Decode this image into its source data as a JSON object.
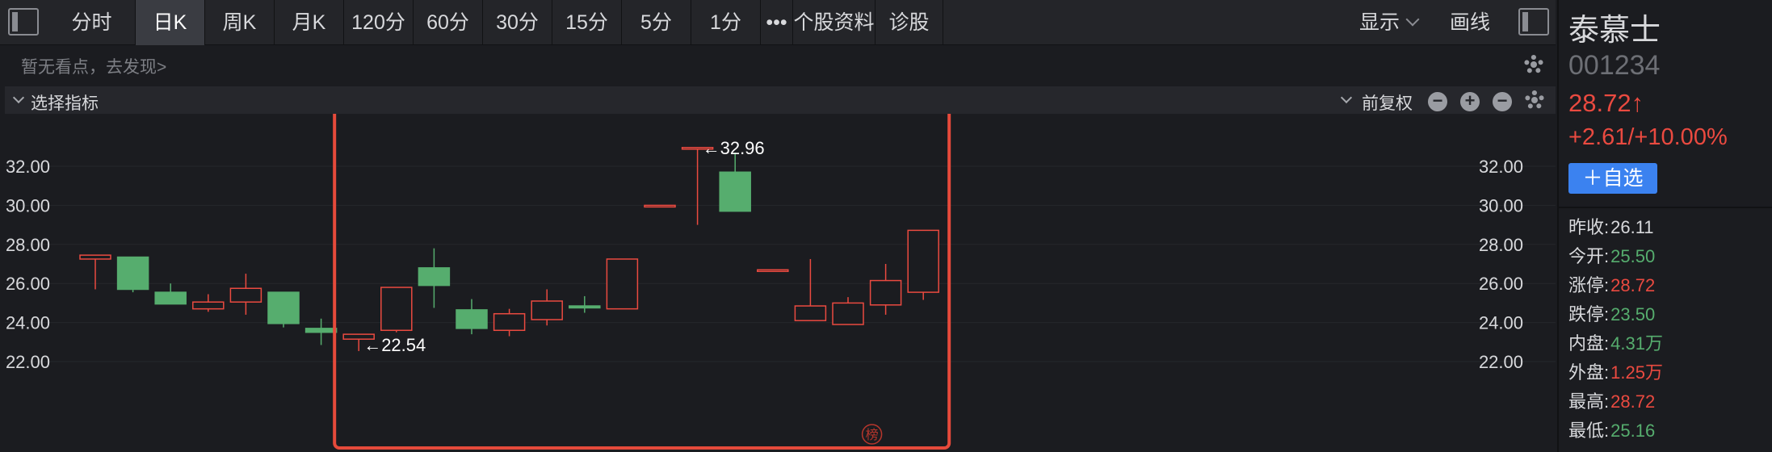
{
  "toolbar": {
    "tabs": [
      {
        "label": "分时",
        "active": false
      },
      {
        "label": "日K",
        "active": true
      },
      {
        "label": "周K",
        "active": false
      },
      {
        "label": "月K",
        "active": false
      },
      {
        "label": "120分",
        "active": false
      },
      {
        "label": "60分",
        "active": false
      },
      {
        "label": "30分",
        "active": false
      },
      {
        "label": "15分",
        "active": false
      },
      {
        "label": "5分",
        "active": false
      },
      {
        "label": "1分",
        "active": false
      },
      {
        "label": "•••",
        "active": false
      },
      {
        "label": "个股资料",
        "active": false
      },
      {
        "label": "诊股",
        "active": false
      }
    ],
    "display_label": "显示",
    "draw_label": "画线"
  },
  "viewpoint": {
    "text": "暂无看点，去发现>"
  },
  "indicator_bar": {
    "select_label": "选择指标",
    "adjust_label": "前复权"
  },
  "chart_data": {
    "type": "candlestick",
    "ylim": [
      22,
      32.96
    ],
    "y_ticks": [
      "32.00",
      "30.00",
      "28.00",
      "26.00",
      "24.00",
      "22.00"
    ],
    "candles": [
      {
        "open": 27.25,
        "close": 27.45,
        "high": 27.4,
        "low": 25.7
      },
      {
        "open": 27.35,
        "close": 25.7,
        "high": 27.35,
        "low": 25.55
      },
      {
        "open": 25.55,
        "close": 24.95,
        "high": 26.0,
        "low": 24.95
      },
      {
        "open": 24.7,
        "close": 25.05,
        "high": 25.45,
        "low": 24.55
      },
      {
        "open": 25.05,
        "close": 25.75,
        "high": 26.5,
        "low": 24.4
      },
      {
        "open": 25.55,
        "close": 23.95,
        "high": 25.55,
        "low": 23.75
      },
      {
        "open": 23.7,
        "close": 23.5,
        "high": 24.2,
        "low": 22.85
      },
      {
        "open": 23.15,
        "close": 23.4,
        "high": 23.4,
        "low": 22.54
      },
      {
        "open": 23.6,
        "close": 25.8,
        "high": 25.8,
        "low": 23.5
      },
      {
        "open": 26.8,
        "close": 25.9,
        "high": 27.8,
        "low": 24.75
      },
      {
        "open": 24.65,
        "close": 23.7,
        "high": 25.2,
        "low": 23.4
      },
      {
        "open": 23.6,
        "close": 24.45,
        "high": 24.7,
        "low": 23.3
      },
      {
        "open": 24.15,
        "close": 25.1,
        "high": 25.7,
        "low": 23.85
      },
      {
        "open": 24.85,
        "close": 24.75,
        "high": 25.35,
        "low": 24.5
      },
      {
        "open": 24.7,
        "close": 27.25,
        "high": 27.25,
        "low": 24.7
      },
      {
        "open": 30.0,
        "close": 30.0,
        "high": 30.0,
        "low": 30.0
      },
      {
        "open": 32.96,
        "close": 32.96,
        "high": 32.96,
        "low": 29.0
      },
      {
        "open": 31.7,
        "close": 29.7,
        "high": 32.7,
        "low": 29.7
      },
      {
        "open": 26.7,
        "close": 26.7,
        "high": 26.7,
        "low": 26.7
      },
      {
        "open": 24.1,
        "close": 24.85,
        "high": 27.25,
        "low": 24.1
      },
      {
        "open": 23.9,
        "close": 25.0,
        "high": 25.3,
        "low": 23.9
      },
      {
        "open": 24.9,
        "close": 26.15,
        "high": 27.0,
        "low": 24.4
      },
      {
        "open": 25.55,
        "close": 28.72,
        "high": 28.72,
        "low": 25.16
      }
    ],
    "annotations": [
      {
        "text": "←32.96",
        "value": 32.96,
        "candle": 16
      },
      {
        "text": "←22.54",
        "value": 22.54,
        "candle": 7
      }
    ],
    "highlight": {
      "from_candle": 7,
      "to_candle": 22,
      "color": "#e64a3b"
    },
    "badge_text": "榜",
    "up_color": "#ea4a40",
    "down_color": "#56ad6e"
  },
  "quote": {
    "name": "泰慕士",
    "code": "001234",
    "price": "28.72↑",
    "change": "+2.61/+10.00%",
    "add_button": "＋自选",
    "stats": [
      {
        "label": "昨收:",
        "value": "26.11",
        "color": "#d8d9dc"
      },
      {
        "label": "今开:",
        "value": "25.50",
        "color": "#56ad6e"
      },
      {
        "label": "涨停:",
        "value": "28.72",
        "color": "#ea4a40"
      },
      {
        "label": "跌停:",
        "value": "23.50",
        "color": "#56ad6e"
      },
      {
        "label": "内盘:",
        "value": "4.31万",
        "color": "#56ad6e"
      },
      {
        "label": "外盘:",
        "value": "1.25万",
        "color": "#ea4a40"
      },
      {
        "label": "最高:",
        "value": "28.72",
        "color": "#ea4a40"
      },
      {
        "label": "最低:",
        "value": "25.16",
        "color": "#56ad6e"
      }
    ]
  }
}
